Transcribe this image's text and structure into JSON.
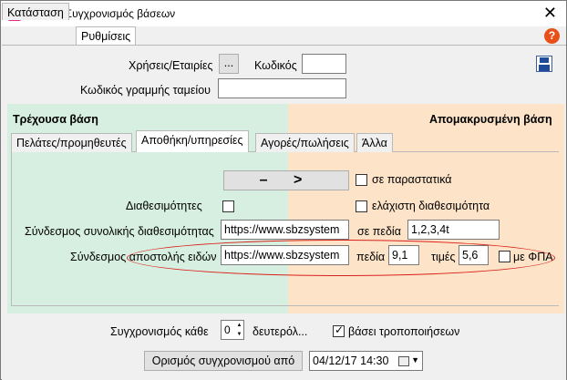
{
  "window": {
    "title": "EMDI - Συγχρονισμός βάσεων",
    "close_label": "✕"
  },
  "top_tabs": [
    {
      "label": "Κατάσταση"
    },
    {
      "label": "Ρυθμίσεις"
    }
  ],
  "help": {
    "label": "?"
  },
  "settings": {
    "years_label": "Χρήσεις/Εταιρίες",
    "years_button": "...",
    "code_label": "Κωδικός",
    "code_value": "",
    "cashline_label": "Κωδικός γραμμής ταμείου",
    "cashline_value": ""
  },
  "panes": {
    "current": "Τρέχουσα βάση",
    "remote": "Απομακρυσμένη βάση"
  },
  "inner_tabs": [
    {
      "label": "Πελάτες/προμηθευτές"
    },
    {
      "label": "Αποθήκη/υπηρεσίες"
    },
    {
      "label": "Αγορές/πωλήσεις"
    },
    {
      "label": "Άλλα"
    }
  ],
  "warehouse": {
    "transfer_button": "– >",
    "in_documents_label": "σε παραστατικά",
    "availability_label": "Διαθεσιμότητες",
    "min_availability_label": "ελάχιστη διαθεσιμότητα",
    "total_avail_link_label": "Σύνδεσμος συνολικής διαθεσιμότητας",
    "total_avail_link_value": "https://www.sbzsystem",
    "in_fields_label": "σε πεδία",
    "in_fields_value": "1,2,3,4t",
    "items_link_label": "Σύνδεσμος αποστολής ειδών",
    "items_link_value": "https://www.sbzsystem",
    "fields_label": "πεδία",
    "fields_value": "9,1",
    "prices_label": "τιμές",
    "prices_value": "5,6",
    "with_vat_label": "με ΦΠΑ"
  },
  "sync": {
    "every_label": "Συγχρονισμός κάθε",
    "every_value": "0",
    "seconds_label": "δευτερόλ...",
    "on_changes_label": "βάσει τροποποιήσεων",
    "on_changes_checked": true,
    "schedule_button": "Ορισμός συγχρονισμού από",
    "date_value": "04/12/17 14:30"
  },
  "colors": {
    "green_pane": "#d6efe0",
    "orange_pane": "#fde3c8",
    "annotation_oval": "#d9201a"
  },
  "icons": [
    "app-icon",
    "close-icon",
    "help-icon",
    "save-icon",
    "calendar-icon"
  ]
}
